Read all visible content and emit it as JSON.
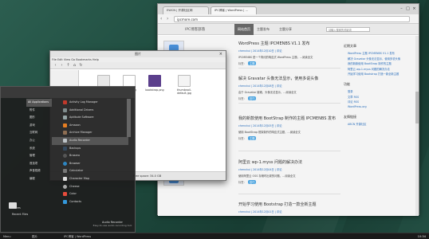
{
  "browser": {
    "tabs": [
      "EWCN | 开源社区网",
      "IPC博客 | WordPress | ..."
    ],
    "url": "ipcmore.com",
    "site_logo": "IPC博客部落",
    "nav": [
      "网站首页",
      "主题发布",
      "主题分享"
    ],
    "nav_active": "网站首页",
    "search_placeholder": "请输入搜索的关键词",
    "posts": [
      {
        "title": "WordPress 主题 IPCMENBS V1.1 发布",
        "meta": "chenshui | 2014年12月10日 | 评论",
        "excerpt": "IPCMENBS 是一个简约的响应式 WordPress 主题，…阅读全文",
        "tags": "标签：",
        "pill": "主题"
      },
      {
        "title": "解决 Gravatar 头像无法显示，使用多说头像",
        "meta": "chenshui | 2014年12月08日 | 评论",
        "excerpt": "由于 Gravatar 被墙，头像无法显示，…阅读全文",
        "tags": "标签：",
        "pill": "技巧"
      },
      {
        "title": "我的新款使用 BootStrap 制作的主题 IPCMENBS 发布",
        "meta": "chenshui | 2014年12月05日 | 评论",
        "excerpt": "使用 BootStrap 框架制作的响应式主题，…阅读全文",
        "tags": "标签：",
        "pill": "主题"
      },
      {
        "title": "阿里云 wp-1.myss 问题的解决办法",
        "meta": "chenshui | 2014年12月04日 | 评论",
        "excerpt": "使用阿里云 OSS 存储时出现的问题，…阅读全文",
        "tags": "标签：",
        "pill": "技巧"
      },
      {
        "title": "开始学习使用 Bootstrap 打造一款全新主题",
        "meta": "chenshui | 2014年12月01日 | 评论",
        "excerpt": "",
        "tags": "",
        "pill": ""
      }
    ],
    "sidebar": {
      "recent_title": "近期文章",
      "recent": [
        "WordPress 主题 IPCMENBS V1.1 发布",
        "解决 Gravatar 头像无法显示，使用多说头像",
        "我的新款使用 BootStrap 制作的主题",
        "阿里云 wp-1.myss 问题的解决办法",
        "开始学习使用 Bootstrap 打造一款全新主题"
      ],
      "func_title": "功能",
      "func": [
        "登录",
        "文章 RSS",
        "评论 RSS",
        "WordPress.org"
      ],
      "friends_title": "友情链接",
      "friends": [
        "ABCN 开源社区"
      ]
    }
  },
  "filemanager": {
    "title": "图片",
    "menu": "File  Edit  View  Go  Bookmarks  Help",
    "files": [
      "",
      "image.png",
      "bootstrap.png",
      "thumbnail-default.jpg"
    ],
    "status": "Free space: 34.0 GB"
  },
  "appmenu": {
    "categories": [
      "All Applications",
      "附件",
      "图形",
      "游戏",
      "互联网",
      "办公",
      "系统",
      "管理",
      "首选项",
      "声音视频",
      "编程",
      "Places",
      "Recent Files"
    ],
    "selected_category": "All Applications",
    "apps": [
      "Activity Log Manager",
      "Additional Drivers",
      "Aptitude Software",
      "Amazon",
      "Archive Manager",
      "Audio Recorder",
      "Backups",
      "Brasero",
      "Browser",
      "Calculator",
      "Character Map",
      "Cheese",
      "Color",
      "Contacts"
    ],
    "selected_app": "Audio Recorder",
    "footer_title": "Audio Recorder",
    "footer_desc": "Easy-to-use audio recording tool",
    "places": [
      "Places",
      "Recent Files"
    ]
  },
  "taskbar": {
    "items": [
      "Menu",
      "图片",
      "IPC博客 | WordPress"
    ],
    "clock": "10:34"
  }
}
